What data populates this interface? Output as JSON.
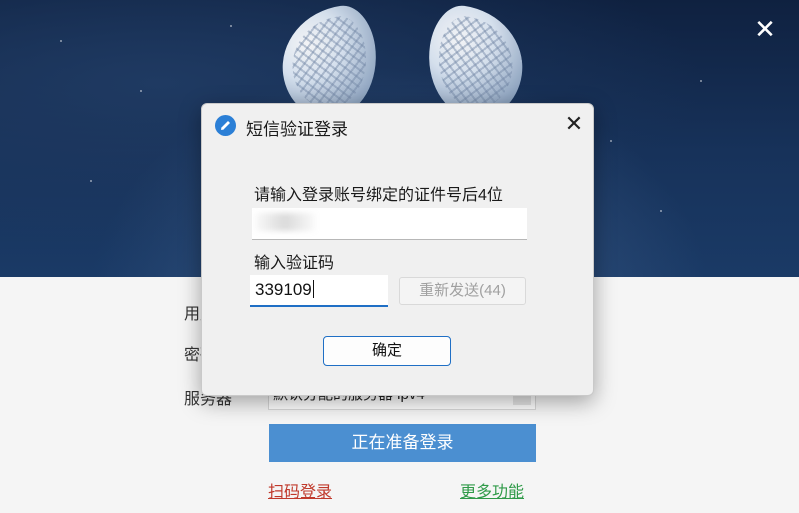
{
  "main_window": {
    "close_glyph": "✕",
    "labels": {
      "user": "用户名",
      "password": "密码",
      "server": "服务器"
    },
    "server_value": "默认分配的服务器 ipv4",
    "login_button": "正在准备登录",
    "scan_login_link": "扫码登录",
    "more_features_link": "更多功能"
  },
  "dialog": {
    "title": "短信验证登录",
    "close_glyph": "✕",
    "prompt": "请输入登录账号绑定的证件号后4位",
    "code_label": "输入验证码",
    "code_value": "339109",
    "resend_button": "重新发送(44)",
    "confirm_button": "确定"
  },
  "colors": {
    "accent": "#1f6fc5",
    "login_button": "#4b8fd1",
    "scan_link": "#c0392b",
    "more_link": "#2f9a48"
  }
}
